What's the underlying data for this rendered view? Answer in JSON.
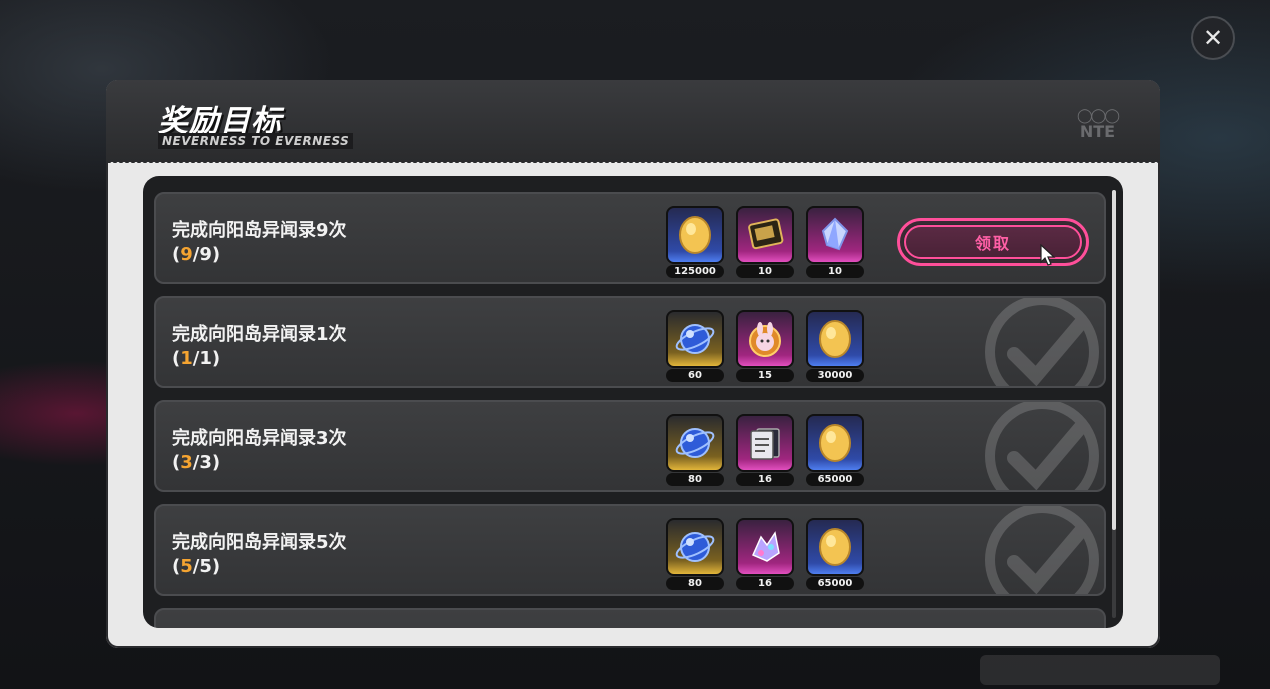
{
  "close_icon_glyph": "✕",
  "panel": {
    "title": "奖励目标",
    "subtitle": "NEVERNESS TO EVERNESS",
    "logo_text": "NTE"
  },
  "tasks": [
    {
      "title": "完成向阳岛异闻录9次",
      "progress_open": "(",
      "progress_current": "9",
      "progress_rest": "/9)",
      "rewards": [
        {
          "icon": "gold-coin-icon",
          "qty": "125000",
          "rarity": "blue"
        },
        {
          "icon": "tablet-device-icon",
          "qty": "10",
          "rarity": "purple"
        },
        {
          "icon": "crystal-shard-icon",
          "qty": "10",
          "rarity": "purple"
        }
      ],
      "status": "claimable",
      "claim_label": "领取"
    },
    {
      "title": "完成向阳岛异闻录1次",
      "progress_open": "(",
      "progress_current": "1",
      "progress_rest": "/1)",
      "rewards": [
        {
          "icon": "blue-orb-icon",
          "qty": "60",
          "rarity": "gold"
        },
        {
          "icon": "bunny-badge-icon",
          "qty": "15",
          "rarity": "purple"
        },
        {
          "icon": "gold-coin-icon",
          "qty": "30000",
          "rarity": "blue"
        }
      ],
      "status": "claimed"
    },
    {
      "title": "完成向阳岛异闻录3次",
      "progress_open": "(",
      "progress_current": "3",
      "progress_rest": "/3)",
      "rewards": [
        {
          "icon": "blue-orb-icon",
          "qty": "80",
          "rarity": "gold"
        },
        {
          "icon": "document-card-icon",
          "qty": "16",
          "rarity": "purple"
        },
        {
          "icon": "gold-coin-icon",
          "qty": "65000",
          "rarity": "blue"
        }
      ],
      "status": "claimed"
    },
    {
      "title": "完成向阳岛异闻录5次",
      "progress_open": "(",
      "progress_current": "5",
      "progress_rest": "/5)",
      "rewards": [
        {
          "icon": "blue-orb-icon",
          "qty": "80",
          "rarity": "gold"
        },
        {
          "icon": "gem-cluster-icon",
          "qty": "16",
          "rarity": "purple"
        },
        {
          "icon": "gold-coin-icon",
          "qty": "65000",
          "rarity": "blue"
        }
      ],
      "status": "claimed"
    }
  ],
  "colors": {
    "accent_pink": "#ff4f9a",
    "progress_orange": "#f5a431"
  }
}
